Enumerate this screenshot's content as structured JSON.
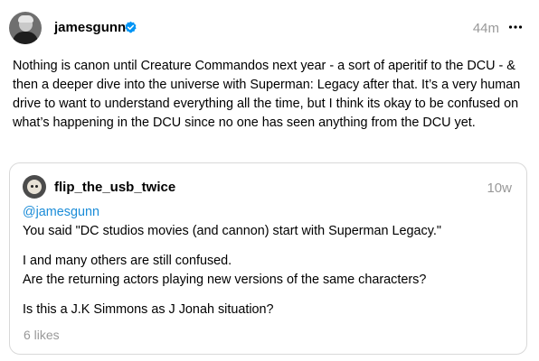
{
  "author": {
    "username": "jamesgunn",
    "verified": true,
    "timestamp": "44m"
  },
  "post": {
    "text": "Nothing is canon until Creature Commandos next year - a sort of aperitif to the DCU - & then a deeper dive into the universe with Superman: Legacy after that. It’s a very human drive to want to understand everything all the time, but I think its okay to be confused on what’s happening in the DCU since no one has seen anything from the DCU yet."
  },
  "quote": {
    "username": "flip_the_usb_twice",
    "timestamp": "10w",
    "mention": "@jamesgunn",
    "line1": "You said \"DC studios movies (and cannon) start with Superman Legacy.\"",
    "line2": "I and many others are still confused.",
    "line3": "Are the returning actors playing new versions of the same characters?",
    "line4": "Is this a J.K Simmons as J Jonah situation?",
    "likes": "6 likes"
  },
  "colors": {
    "mention": "#1a8cd8",
    "muted": "#999999",
    "verified": "#0095f6",
    "border": "#d9d9d9"
  },
  "icons": {
    "verified": "verified-badge-icon",
    "more": "more-options-icon"
  }
}
